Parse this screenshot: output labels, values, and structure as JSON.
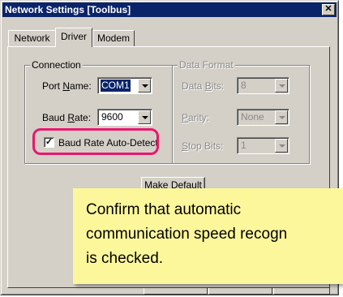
{
  "window": {
    "title": "Network Settings [Toolbus]",
    "close_glyph": "✕"
  },
  "tabs": [
    {
      "label": "Network",
      "active": false
    },
    {
      "label": "Driver",
      "active": true
    },
    {
      "label": "Modem",
      "active": false
    }
  ],
  "connection": {
    "legend": "Connection",
    "port_name": {
      "label_pre": "Port ",
      "label_mnemonic": "N",
      "label_post": "ame:",
      "value": "COM1"
    },
    "baud_rate": {
      "label_pre": "Baud ",
      "label_mnemonic": "R",
      "label_post": "ate:",
      "value": "9600"
    },
    "auto_detect": {
      "label": "Baud Rate Auto-Detect",
      "checked": true,
      "check_glyph": "✓"
    }
  },
  "data_format": {
    "legend": "Data Format",
    "data_bits": {
      "label_pre": "Data ",
      "label_mnemonic": "B",
      "label_post": "its:",
      "value": "8"
    },
    "parity": {
      "label_pre": "",
      "label_mnemonic": "P",
      "label_post": "arity:",
      "value": "None"
    },
    "stop_bits": {
      "label_pre": "",
      "label_mnemonic": "S",
      "label_post": "top Bits:",
      "value": "1"
    }
  },
  "make_default_label": "Make Default",
  "callout": {
    "text": "Confirm that automatic\ncommunication speed recogn\nis checked.",
    "background": "#fdf79c"
  },
  "colors": {
    "title_bar": "#0a246a",
    "highlight_ring": "#e8186e",
    "dialog_face": "#d4d0c8"
  }
}
